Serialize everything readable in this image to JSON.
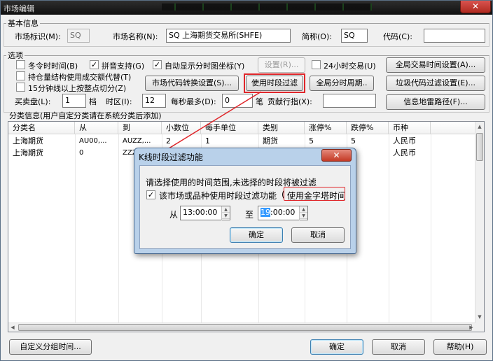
{
  "window": {
    "title": "市场编辑",
    "close_glyph": "✕"
  },
  "basic": {
    "group_title": "基本信息",
    "market_id_label": "市场标识(M):",
    "market_id_value": "SQ",
    "market_name_label": "市场名称(N):",
    "market_name_value": "SQ 上海期货交易所(SHFE)",
    "short_label": "简称(O):",
    "short_value": "SQ",
    "code_label": "代码(C):",
    "code_value": ""
  },
  "options": {
    "group_title": "选项",
    "winter_time": "冬令时时间(B)",
    "pinyin": "拼音支持(G)",
    "auto_axis": "自动显示分时图坐标(Y)",
    "settings_btn": "设置(R)...",
    "h24": "24小时交易(U)",
    "global_time_btn": "全局交易时间设置(A)...",
    "position_struct": "持仓量结构使用成交额代替(T)",
    "code_convert_btn": "市场代码转换设置(S)...",
    "use_time_filter_btn": "使用时段过滤",
    "global_period_btn": "全局分时周期..",
    "junk_code_btn": "垃圾代码过滤设置(E)...",
    "kline_15min": "15分钟线以上按整点切分(Z)",
    "bidask_label": "买卖盘(L):",
    "bidask_value": "1",
    "dang": "档",
    "tz_label": "时区(I):",
    "tz_value": "12",
    "persec_label": "每秒最多(D):",
    "persec_value": "0",
    "bi": "笔",
    "contrib_label": "贡献行指(X):",
    "contrib_value": "",
    "mine_path_btn": "信息地雷路径(F)..."
  },
  "category": {
    "group_title": "分类信息(用户自定分类请在系统分类后添加)",
    "columns": [
      "分类名",
      "从",
      "到",
      "小数位",
      "每手单位",
      "类别",
      "涨停%",
      "跌停%",
      "币种"
    ],
    "rows": [
      [
        "上海期货",
        "AU00,...",
        "AUZZ,...",
        "2",
        "1",
        "期货",
        "5",
        "5",
        "人民币"
      ],
      [
        "上海期货",
        "0",
        "ZZZ",
        "",
        "",
        "",
        "",
        "",
        "人民币"
      ]
    ]
  },
  "footer": {
    "custom_group_btn": "自定义分组时间...",
    "ok_btn": "确定",
    "cancel_btn": "取消",
    "help_btn": "帮助(H)"
  },
  "dialog": {
    "title": "K线时段过滤功能",
    "close_glyph": "✕",
    "instruction": "请选择使用的时间范围,未选择的时段将被过滤",
    "enable_label": "该市场或品种使用时段过滤功能",
    "pyramid_label": "使用金字塔时间",
    "from_label": "从",
    "from_value": "13:00:00",
    "to_label": "至",
    "to_value_sel": "19",
    "to_value_rest": ":00:00",
    "ok_btn": "确定",
    "cancel_btn": "取消"
  },
  "colors": {
    "highlight_red": "#e0262a",
    "selection_blue": "#3399ff"
  }
}
